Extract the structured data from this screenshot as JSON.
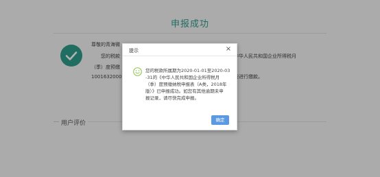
{
  "page": {
    "title": "申报成功",
    "content": {
      "greeting": "尊敬的青海微",
      "line2_left": "您的税款",
      "line3_left": "（季）度预缴",
      "line4_left": "1001632000",
      "line2_right": "中华人民共和国企业所得税月",
      "line3_right": "：",
      "line4_right": "需进行缴款。"
    },
    "evaluation_label": "用户评价"
  },
  "modal": {
    "title": "提示",
    "close_glyph": "×",
    "message_lines": [
      "您的税款所属期为2020-01-01至2020-03",
      "-31的《中华人民共和国企业所得税月",
      "（季）度预缴纳税申报表（A类，2018年",
      "版）》已申报成功。如您有其他逾期未申",
      "报记录，请尽快完成申报。"
    ],
    "confirm_label": "确定"
  },
  "colors": {
    "accent": "#2f9d8c",
    "button": "#5b9ae0",
    "smile": "#8bc34a"
  }
}
